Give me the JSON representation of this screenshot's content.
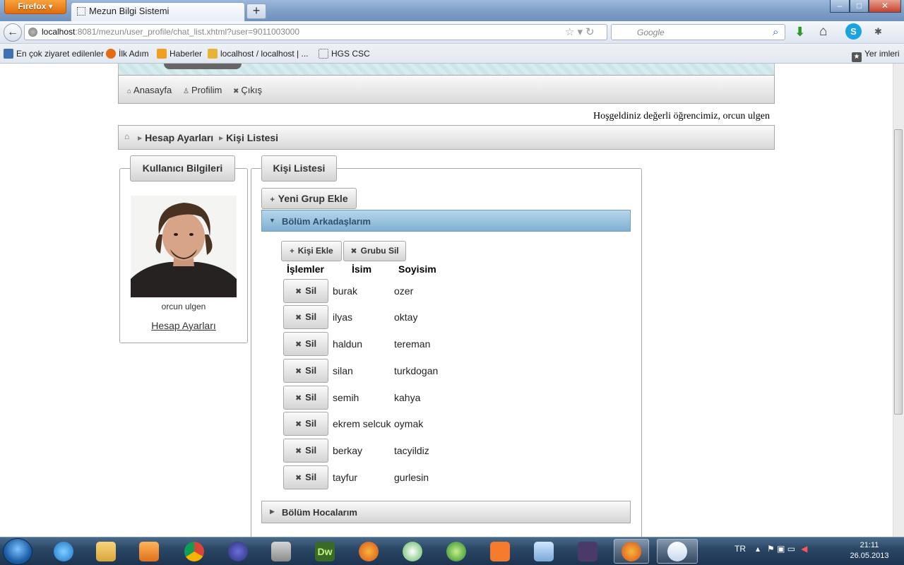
{
  "browser": {
    "menu_button": "Firefox",
    "tab_title": "Mezun Bilgi Sistemi",
    "new_tab": "+",
    "url_host": "localhost",
    "url_rest": ":8081/mezun/user_profile/chat_list.xhtml?user=9011003000",
    "search_placeholder": "Google",
    "search_engine": "g",
    "bookmarks": [
      "En çok ziyaret edilenler",
      "İlk Adım",
      "Haberler",
      "localhost / localhost | ...",
      "HGS CSC"
    ],
    "bookmarks_right": "Yer imleri",
    "window_buttons": [
      "–",
      "□",
      "✕"
    ]
  },
  "menu": [
    {
      "icon": "home-icon",
      "label": "Anasayfa"
    },
    {
      "icon": "user-icon",
      "label": "Profilim"
    },
    {
      "icon": "close-icon",
      "label": "Çıkış"
    }
  ],
  "welcome": "Hoşgeldiniz değerli öğrencimiz, orcun ulgen",
  "breadcrumb": [
    "Hesap Ayarları",
    "Kişi Listesi"
  ],
  "user_panel": {
    "legend": "Kullanıcı Bilgileri",
    "name": "orcun ulgen",
    "settings_link": "Hesap Ayarları"
  },
  "contacts_panel": {
    "legend": "Kişi Listesi",
    "new_group_button": "Yeni Grup Ekle",
    "group_a": {
      "title": "Bölüm Arkadaşlarım",
      "add_contact_button": "Kişi Ekle",
      "delete_group_button": "Grubu Sil",
      "columns": [
        "İşlemler",
        "İsim",
        "Soyisim"
      ],
      "delete_label": "Sil",
      "rows": [
        {
          "first": "burak",
          "last": "ozer"
        },
        {
          "first": "ilyas",
          "last": "oktay"
        },
        {
          "first": "haldun",
          "last": "tereman"
        },
        {
          "first": "silan",
          "last": "turkdogan"
        },
        {
          "first": "semih",
          "last": "kahya"
        },
        {
          "first": "ekrem selcuk",
          "last": "oymak"
        },
        {
          "first": "berkay",
          "last": "tacyildiz"
        },
        {
          "first": "tayfur",
          "last": "gurlesin"
        }
      ]
    },
    "group_b": {
      "title": "Bölüm Hocalarım"
    }
  },
  "taskbar": {
    "language": "TR",
    "time": "21:11",
    "date": "26.05.2013"
  }
}
